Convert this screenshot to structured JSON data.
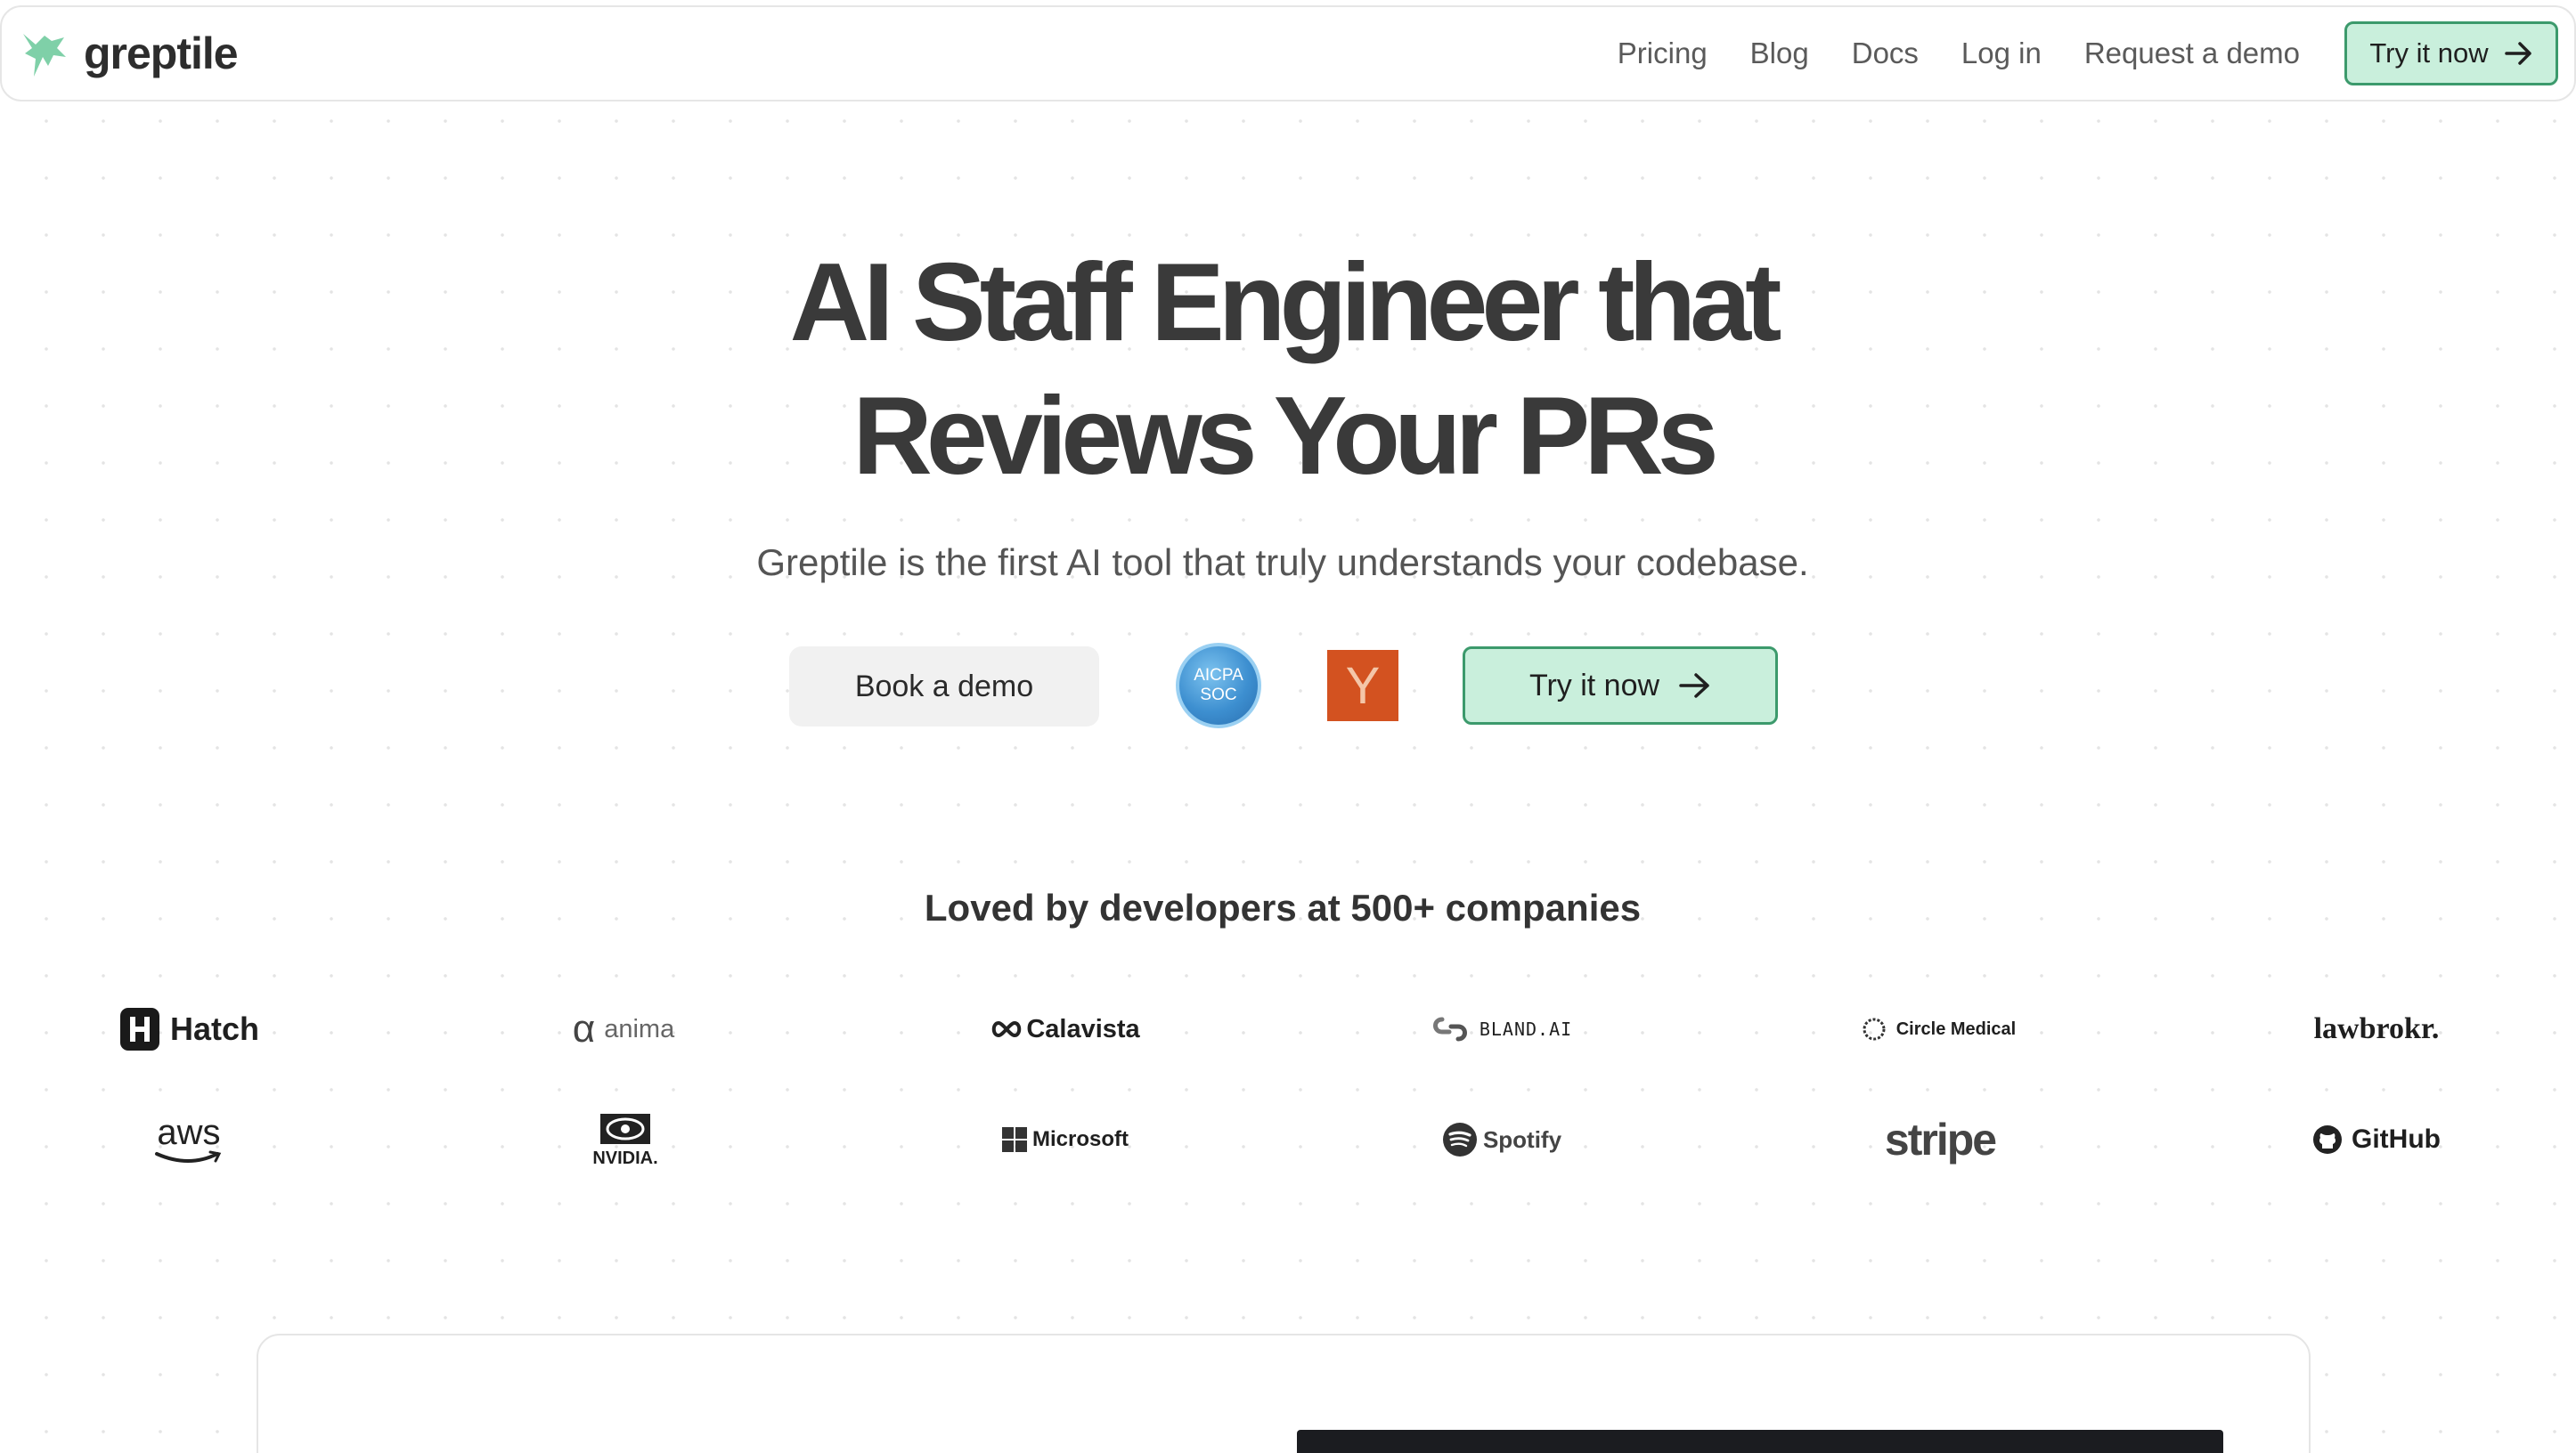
{
  "brand": {
    "name": "greptile",
    "logo_icon": "lizard-icon",
    "accent": "#7fd0a8"
  },
  "nav": {
    "links": [
      "Pricing",
      "Blog",
      "Docs",
      "Log in",
      "Request a demo"
    ],
    "cta_label": "Try it now"
  },
  "hero": {
    "title_line1": "AI Staff Engineer that",
    "title_line2": "Reviews Your PRs",
    "subtitle": "Greptile is the first AI tool that truly understands your codebase.",
    "book_demo_label": "Book a demo",
    "soc_badge": {
      "line1": "AICPA",
      "line2": "SOC"
    },
    "yc_badge": "Y",
    "try_label": "Try it now"
  },
  "social_proof": {
    "heading": "Loved by developers at 500+ companies",
    "row1": [
      "Hatch",
      "anima",
      "Calavista",
      "BLAND.AI",
      "Circle Medical",
      "lawbrokr."
    ],
    "row2": [
      "aws",
      "NVIDIA.",
      "Microsoft",
      "Spotify",
      "stripe",
      "GitHub"
    ]
  },
  "colors": {
    "cta_fill": "#c9efdc",
    "cta_border": "#3c9a6c",
    "yc_orange": "#d35220",
    "soc_blue": "#3d8fd0"
  }
}
